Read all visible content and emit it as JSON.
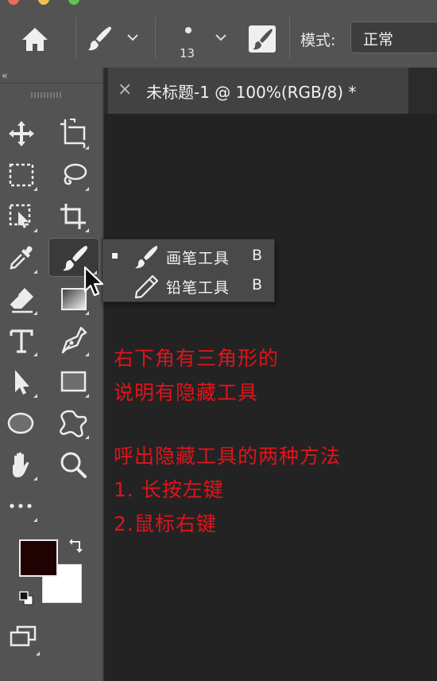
{
  "options_bar": {
    "brush_size": "13",
    "mode_label": "模式:",
    "mode_value": "正常"
  },
  "document": {
    "tab_title": "未标题-1 @ 100%(RGB/8) *",
    "close_glyph": "×"
  },
  "toolbar": {
    "collapse_glyph": "‹‹",
    "tools": [
      {
        "name": "move-tool"
      },
      {
        "name": "artboard-tool"
      },
      {
        "name": "marquee-tool"
      },
      {
        "name": "lasso-tool"
      },
      {
        "name": "object-selection-tool"
      },
      {
        "name": "crop-tool"
      },
      {
        "name": "eyedropper-tool"
      },
      {
        "name": "brush-tool",
        "active": true
      },
      {
        "name": "eraser-tool"
      },
      {
        "name": "gradient-tool"
      },
      {
        "name": "type-tool"
      },
      {
        "name": "pen-tool"
      },
      {
        "name": "path-selection-tool"
      },
      {
        "name": "rectangle-tool"
      },
      {
        "name": "ellipse-tool"
      },
      {
        "name": "custom-shape-tool"
      },
      {
        "name": "hand-tool"
      },
      {
        "name": "zoom-tool"
      },
      {
        "name": "more-tools"
      }
    ],
    "foreground_color": "#1f0303",
    "background_color": "#ffffff"
  },
  "flyout": {
    "items": [
      {
        "label": "画笔工具",
        "shortcut": "B",
        "icon": "brush-icon",
        "selected": true
      },
      {
        "label": "铅笔工具",
        "shortcut": "B",
        "icon": "pencil-icon",
        "selected": false
      }
    ]
  },
  "annotations": {
    "line1": "右下角有三角形的",
    "line2": "说明有隐藏工具",
    "line3": "呼出隐藏工具的两种方法",
    "line4": "1. 长按左键",
    "line5": "2.鼠标右键",
    "color": "#e0141a"
  }
}
